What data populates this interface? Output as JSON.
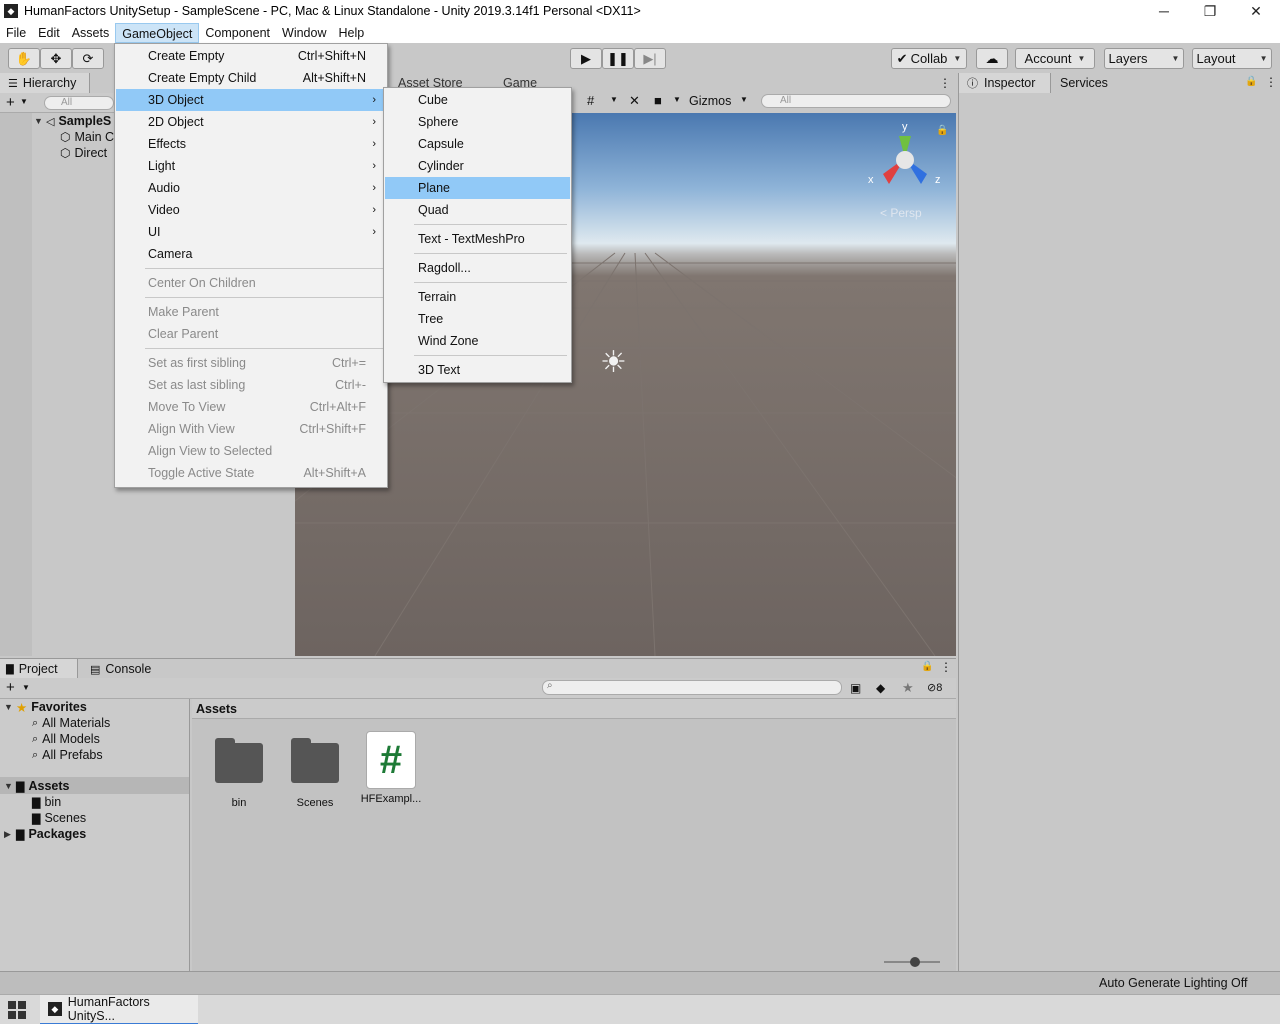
{
  "window": {
    "title": "HumanFactors UnitySetup - SampleScene - PC, Mac & Linux Standalone - Unity 2019.3.14f1 Personal <DX11>",
    "minimize": "─",
    "restore": "❐",
    "close": "✕"
  },
  "menubar": {
    "items": [
      "File",
      "Edit",
      "Assets",
      "GameObject",
      "Component",
      "Window",
      "Help"
    ],
    "active": "GameObject"
  },
  "toolbar": {
    "collab": "Collab",
    "account": "Account",
    "layers": "Layers",
    "layout": "Layout"
  },
  "hierarchy": {
    "tab": "Hierarchy",
    "search_placeholder": "All",
    "scene": "SampleS",
    "items": [
      "Main C",
      "Direct"
    ]
  },
  "scene": {
    "tabs": [
      "Asset Store",
      "Game"
    ],
    "gizmos": "Gizmos",
    "search_placeholder": "All",
    "persp": "< Persp",
    "axes": {
      "y": "y",
      "x": "x",
      "z": "z"
    }
  },
  "gameobject_menu": {
    "items": [
      {
        "label": "Create Empty",
        "shortcut": "Ctrl+Shift+N"
      },
      {
        "label": "Create Empty Child",
        "shortcut": "Alt+Shift+N"
      },
      {
        "label": "3D Object",
        "submenu": true
      },
      {
        "label": "2D Object",
        "submenu": true
      },
      {
        "label": "Effects",
        "submenu": true
      },
      {
        "label": "Light",
        "submenu": true
      },
      {
        "label": "Audio",
        "submenu": true
      },
      {
        "label": "Video",
        "submenu": true
      },
      {
        "label": "UI",
        "submenu": true
      },
      {
        "label": "Camera"
      },
      {
        "label": "Center On Children"
      },
      {
        "label": "Make Parent"
      },
      {
        "label": "Clear Parent"
      },
      {
        "label": "Set as first sibling",
        "shortcut": "Ctrl+="
      },
      {
        "label": "Set as last sibling",
        "shortcut": "Ctrl+-"
      },
      {
        "label": "Move To View",
        "shortcut": "Ctrl+Alt+F"
      },
      {
        "label": "Align With View",
        "shortcut": "Ctrl+Shift+F"
      },
      {
        "label": "Align View to Selected"
      },
      {
        "label": "Toggle Active State",
        "shortcut": "Alt+Shift+A"
      }
    ]
  },
  "submenu_3d": {
    "items": [
      "Cube",
      "Sphere",
      "Capsule",
      "Cylinder",
      "Plane",
      "Quad",
      "Text - TextMeshPro",
      "Ragdoll...",
      "Terrain",
      "Tree",
      "Wind Zone",
      "3D Text"
    ],
    "highlighted": "Plane"
  },
  "inspector": {
    "tabs": [
      "Inspector",
      "Services"
    ]
  },
  "project": {
    "tabs": [
      "Project",
      "Console"
    ],
    "favorites": "Favorites",
    "favorite_items": [
      "All Materials",
      "All Models",
      "All Prefabs"
    ],
    "assets_label": "Assets",
    "asset_folders": [
      "bin",
      "Scenes"
    ],
    "packages": "Packages",
    "breadcrumb": "Assets",
    "assets": [
      {
        "name": "bin",
        "kind": "folder"
      },
      {
        "name": "Scenes",
        "kind": "folder"
      },
      {
        "name": "HFExampl...",
        "kind": "script"
      }
    ],
    "hidden_count": "8"
  },
  "status": {
    "text": "Auto Generate Lighting Off"
  },
  "taskbar": {
    "app": "HumanFactors UnityS..."
  }
}
